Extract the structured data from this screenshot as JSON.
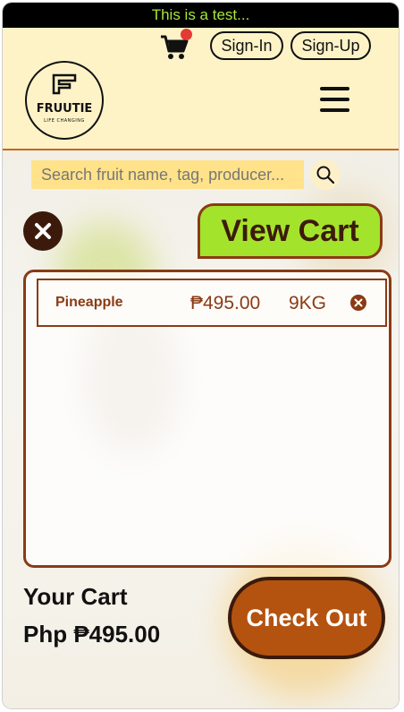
{
  "banner": {
    "text": "This is a test..."
  },
  "header": {
    "signin_label": "Sign-In",
    "signup_label": "Sign-Up",
    "logo_name": "FRUUTIE",
    "logo_tagline": "LIFE CHANGING"
  },
  "search": {
    "placeholder": "Search fruit name, tag, producer..."
  },
  "cart": {
    "view_cart_label": "View Cart",
    "items": [
      {
        "name": "Pineapple",
        "price": "₱495.00",
        "qty": "9KG"
      }
    ],
    "your_cart_label": "Your Cart",
    "total_text": "Php ₱495.00",
    "checkout_label": "Check Out"
  },
  "colors": {
    "banner_bg": "#000000",
    "banner_text": "#a8e63a",
    "header_bg": "#fdf3c7",
    "accent_brown": "#8a3b14",
    "view_cart_bg": "#a4e32c",
    "search_bg": "#ffe28a",
    "checkout_bg": "#b3530f",
    "notification_dot": "#e53935"
  },
  "icons": [
    "cart-icon",
    "hamburger-menu-icon",
    "search-icon",
    "close-icon",
    "remove-item-icon"
  ]
}
